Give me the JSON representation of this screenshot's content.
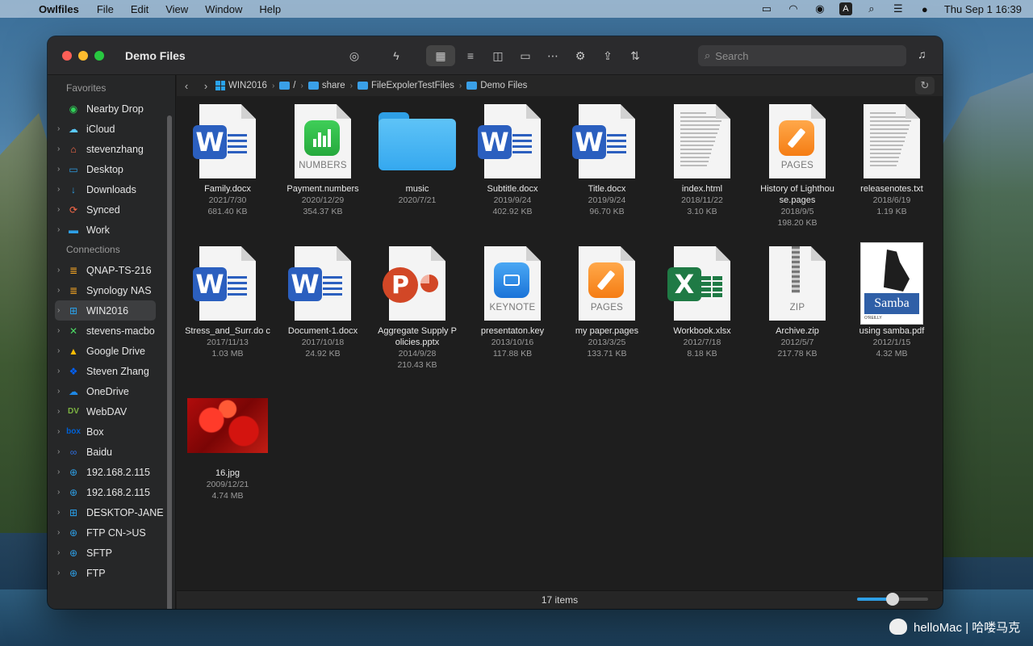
{
  "menubar": {
    "app": "Owlfiles",
    "menus": [
      "File",
      "Edit",
      "View",
      "Window",
      "Help"
    ],
    "date_time": "Thu Sep 1  16:39",
    "input_badge": "A"
  },
  "window": {
    "title": "Demo Files",
    "search_placeholder": "Search"
  },
  "sidebar": {
    "favorites_label": "Favorites",
    "connections_label": "Connections",
    "favorites": [
      {
        "label": "Nearby Drop",
        "icon": "nearby-drop-icon",
        "color": "#30d158"
      },
      {
        "label": "iCloud",
        "icon": "icloud-icon",
        "color": "#5ac8fa"
      },
      {
        "label": "stevenzhang",
        "icon": "home-icon",
        "color": "#ff6b4a"
      },
      {
        "label": "Desktop",
        "icon": "desktop-icon",
        "color": "#2e9fe6"
      },
      {
        "label": "Downloads",
        "icon": "download-icon",
        "color": "#2e9fe6"
      },
      {
        "label": "Synced",
        "icon": "sync-icon",
        "color": "#ff6b4a"
      },
      {
        "label": "Work",
        "icon": "folder-icon",
        "color": "#2e9fe6"
      }
    ],
    "connections": [
      {
        "label": "QNAP-TS-216",
        "icon": "nas-icon",
        "color": "#f5a623"
      },
      {
        "label": "Synology NAS",
        "icon": "nas-icon",
        "color": "#f5a623"
      },
      {
        "label": "WIN2016",
        "icon": "windows-icon",
        "color": "#2aa3ef",
        "selected": true
      },
      {
        "label": "stevens-macbo",
        "icon": "mac-icon",
        "color": "#4cd964"
      },
      {
        "label": "Google Drive",
        "icon": "google-drive-icon",
        "color": "#fbbc05"
      },
      {
        "label": "Steven Zhang",
        "icon": "dropbox-icon",
        "color": "#0061fe"
      },
      {
        "label": "OneDrive",
        "icon": "onedrive-icon",
        "color": "#1e88e5"
      },
      {
        "label": "WebDAV",
        "icon": "webdav-icon",
        "color": "#7cb342"
      },
      {
        "label": "Box",
        "icon": "box-icon",
        "color": "#0061d5"
      },
      {
        "label": "Baidu",
        "icon": "baidu-icon",
        "color": "#2f6fe0"
      },
      {
        "label": "192.168.2.115",
        "icon": "globe-icon",
        "color": "#2e9fe6"
      },
      {
        "label": "192.168.2.115",
        "icon": "globe-icon",
        "color": "#2e9fe6"
      },
      {
        "label": "DESKTOP-JANE",
        "icon": "windows-icon",
        "color": "#2aa3ef"
      },
      {
        "label": "FTP CN->US",
        "icon": "globe-icon",
        "color": "#2e9fe6"
      },
      {
        "label": "SFTP",
        "icon": "globe-icon",
        "color": "#2e9fe6"
      },
      {
        "label": "FTP",
        "icon": "globe-icon",
        "color": "#2e9fe6"
      }
    ]
  },
  "pathbar": {
    "segments": [
      "WIN2016",
      "/",
      "share",
      "FileExpolerTestFiles",
      "Demo Files"
    ]
  },
  "files": [
    {
      "name": "Family.docx",
      "date": "2021/7/30",
      "size": "681.40 KB",
      "kind": "word"
    },
    {
      "name": "Payment.numbers",
      "date": "2020/12/29",
      "size": "354.37 KB",
      "kind": "numbers",
      "caption": "NUMBERS"
    },
    {
      "name": "music",
      "date": "2020/7/21",
      "size": "",
      "kind": "folder"
    },
    {
      "name": "Subtitle.docx",
      "date": "2019/9/24",
      "size": "402.92 KB",
      "kind": "word"
    },
    {
      "name": "Title.docx",
      "date": "2019/9/24",
      "size": "96.70 KB",
      "kind": "word"
    },
    {
      "name": "index.html",
      "date": "2018/11/22",
      "size": "3.10 KB",
      "kind": "text"
    },
    {
      "name": "History of Lighthou se.pages",
      "date": "2018/9/5",
      "size": "198.20 KB",
      "kind": "pages",
      "caption": "PAGES"
    },
    {
      "name": "releasenotes.txt",
      "date": "2018/6/19",
      "size": "1.19 KB",
      "kind": "text"
    },
    {
      "name": "Stress_and_Surr.do c",
      "date": "2017/11/13",
      "size": "1.03 MB",
      "kind": "word"
    },
    {
      "name": "Document-1.docx",
      "date": "2017/10/18",
      "size": "24.92 KB",
      "kind": "word"
    },
    {
      "name": "Aggregate Supply P olicies.pptx",
      "date": "2014/9/28",
      "size": "210.43 KB",
      "kind": "powerpoint"
    },
    {
      "name": "presentaton.key",
      "date": "2013/10/16",
      "size": "117.88 KB",
      "kind": "keynote",
      "caption": "KEYNOTE"
    },
    {
      "name": "my paper.pages",
      "date": "2013/3/25",
      "size": "133.71 KB",
      "kind": "pages",
      "caption": "PAGES"
    },
    {
      "name": "Workbook.xlsx",
      "date": "2012/7/18",
      "size": "8.18 KB",
      "kind": "excel"
    },
    {
      "name": "Archive.zip",
      "date": "2012/5/7",
      "size": "217.78 KB",
      "kind": "zip",
      "caption": "ZIP"
    },
    {
      "name": "using samba.pdf",
      "date": "2012/1/15",
      "size": "4.32 MB",
      "kind": "pdf",
      "cover_title": "Samba",
      "cover_subtitle": "Using",
      "cover_publisher": "O'REILLY"
    },
    {
      "name": "16.jpg",
      "date": "2009/12/21",
      "size": "4.74 MB",
      "kind": "image"
    }
  ],
  "status": {
    "count": "17 items",
    "zoom_fraction": 0.5
  },
  "watermark": {
    "text": "helloMac | 哈喽马克"
  }
}
